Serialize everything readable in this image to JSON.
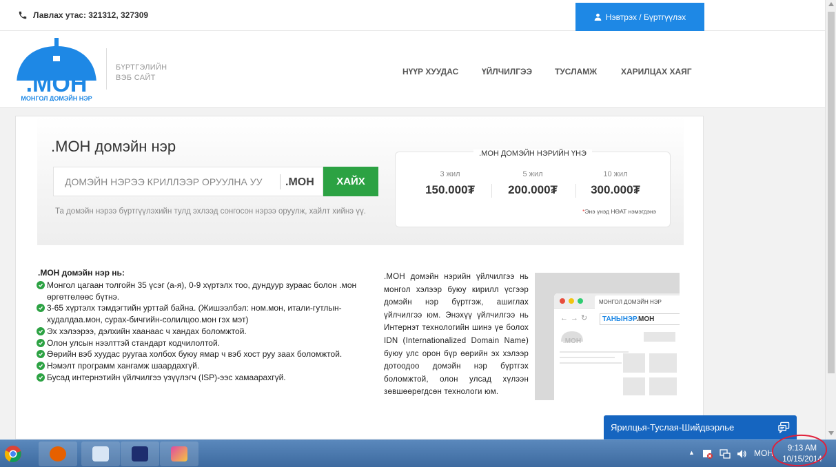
{
  "topbar": {
    "phone_label": "Лавлах утас: 321312, 327309",
    "login_label": "Нэвтрэх / Бүртгүүлэх"
  },
  "logo": {
    "mark": ".МОН",
    "tagline": "МОНГОЛ ДОМЭЙН НЭР",
    "subtitle_line1": "БҮРТГЭЛИЙН",
    "subtitle_line2": "ВЭБ САЙТ"
  },
  "nav": {
    "items": [
      {
        "label": "НҮҮР ХУУДАС"
      },
      {
        "label": "ҮЙЛЧИЛГЭЭ"
      },
      {
        "label": "ТУСЛАМЖ"
      },
      {
        "label": "ХАРИЛЦАХ ХАЯГ"
      }
    ]
  },
  "search": {
    "title": ".МОН домэйн нэр",
    "placeholder": "ДОМЭЙН НЭРЭЭ КРИЛЛЭЭР ОРУУЛНА УУ",
    "extension": ".МОН",
    "button_label": "ХАЙХ",
    "hint": "Та домэйн нэрээ бүртгүүлэхийн тулд эхлээд сонгосон нэрээ оруулж, хайлт хийнэ үү."
  },
  "prices": {
    "title": ".МОН ДОМЭЙН НЭРИЙН ҮНЭ",
    "items": [
      {
        "period": "3 жил",
        "price": "150.000₮"
      },
      {
        "period": "5 жил",
        "price": "200.000₮"
      },
      {
        "period": "10 жил",
        "price": "300.000₮"
      }
    ],
    "note_star": "*",
    "note": "Энэ үнэд НӨАТ нэмэгдэнэ"
  },
  "features": {
    "title": ".МОН домэйн нэр нь:",
    "items": [
      "Монгол цагаан толгойн 35 үсэг (а-я), 0-9 хүртэлх тоо, дундуур зураас болон .мон өргөтгөлөөс бүтнэ.",
      "3-65 хүртэлх тэмдэгтийн урттай байна. (Жишээлбэл: ном.мон, итали-гутлын-худалдаа.мон, сурах-бичгийн-солилцоо.мон гэх мэт)",
      "Эх хэлээрээ, дэлхийн хаанаас ч хандах боломжтой.",
      "Олон улсын нээлттэй стандарт кодчилолтой.",
      "Өөрийн вэб хуудас руугаа холбох буюу ямар ч вэб хост руу заах боломжтой.",
      "Нэмэлт программ хангамж шаардахгүй.",
      "Бусад интернэтийн үйлчилгээ үзүүлэгч (ISP)-ээс хамаарахгүй."
    ]
  },
  "description": {
    "text": ".МОН домэйн нэрийн үйлчилгээ нь монгол хэлээр буюу кирилл үсгээр домэйн нэр бүртгэж, ашиглах үйлчилгээ юм. Энэхүү үйлчилгээ нь Интернэт технологийн шинэ үе болох IDN (Internationalized Domain Name) буюу улс орон бүр өөрийн эх хэлээр дотоодоо домэйн нэр бүртгэх боломжтой, олон улсад хүлээн зөвшөөрөгдсөн технологи юм."
  },
  "illustration": {
    "tab_label": "МОНГОЛ ДОМЭЙН НЭР",
    "url_highlight": "ТАНЫНЭР",
    "url_suffix": ".МОН",
    "mini_logo": ".МОН"
  },
  "chat": {
    "label": "Ярилцья-Туслая-Шийдвэрлье"
  },
  "taskbar": {
    "language": "МОН",
    "time": "9:13 AM",
    "date": "10/15/2014"
  },
  "colors": {
    "brand_blue": "#1e88e5",
    "green": "#2ca243",
    "chat_blue": "#1565c0",
    "annotation_red": "#e0203a"
  }
}
